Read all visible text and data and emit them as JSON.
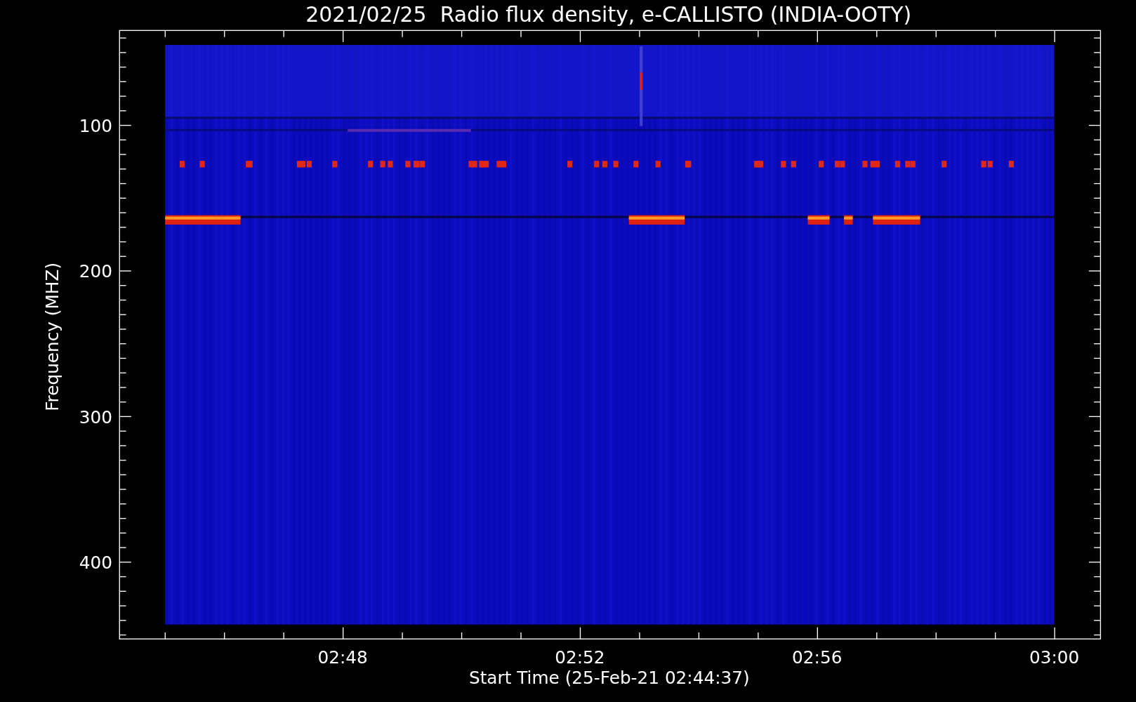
{
  "chart": {
    "title": "2021/02/25  Radio flux density, e-CALLISTO (INDIA-OOTY)",
    "xlabel": "Start Time (25-Feb-21 02:44:37)",
    "ylabel": "Frequency (MHZ)",
    "xtick_labels": [
      "02:48",
      "02:52",
      "02:56",
      "03:00"
    ],
    "ytick_labels": [
      "100",
      "200",
      "300",
      "400"
    ]
  }
}
